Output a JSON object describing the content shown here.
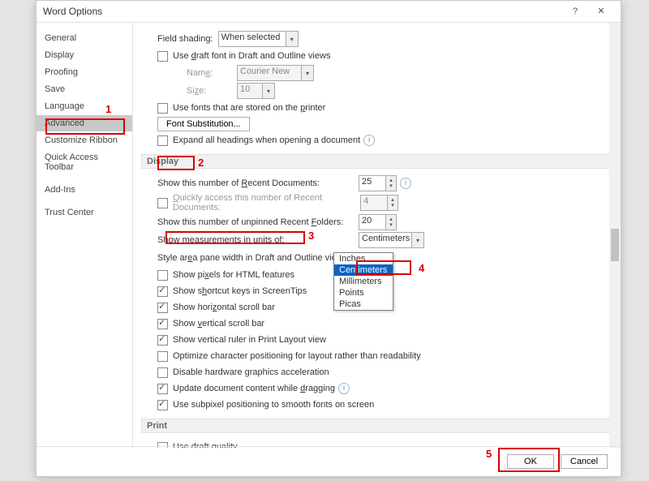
{
  "title": "Word Options",
  "sidebar": {
    "items": [
      "General",
      "Display",
      "Proofing",
      "Save",
      "Language",
      "Advanced",
      "Customize Ribbon",
      "Quick Access Toolbar",
      "Add-Ins",
      "Trust Center"
    ]
  },
  "fs": {
    "label": "Field shading:",
    "value": "When selected",
    "draftfont": "Use draft font in Draft and Outline views",
    "name_label": "Name:",
    "name_value": "Courier New",
    "size_label": "Size:",
    "size_value": "10",
    "printerfonts": "Use fonts that are stored on the printer",
    "fontsub_btn": "Font Substitution...",
    "expand": "Expand all headings when opening a document"
  },
  "sec_display": "Display",
  "disp": {
    "recent_label": "Show this number of Recent Documents:",
    "recent_value": "25",
    "quick_label": "Quickly access this number of Recent Documents:",
    "quick_value": "4",
    "folders_label": "Show this number of unpinned Recent Folders:",
    "folders_value": "20",
    "units_label": "Show measurements in units of:",
    "units_value": "Centimeters",
    "pane_label": "Style area pane width in Draft and Outline views:",
    "cb_pixels": "Show pixels for HTML features",
    "cb_shortcut": "Show shortcut keys in ScreenTips",
    "cb_hscroll": "Show horizontal scroll bar",
    "cb_vscroll": "Show vertical scroll bar",
    "cb_vruler": "Show vertical ruler in Print Layout view",
    "cb_optimize": "Optimize character positioning for layout rather than readability",
    "cb_hwaccel": "Disable hardware graphics acceleration",
    "cb_dragupdate": "Update document content while dragging",
    "cb_subpixel": "Use subpixel positioning to smooth fonts on screen"
  },
  "sec_print": "Print",
  "print": {
    "draft": "Use draft quality"
  },
  "dropdown": {
    "items": [
      "Inches",
      "Centimeters",
      "Millimeters",
      "Points",
      "Picas"
    ]
  },
  "footer": {
    "ok": "OK",
    "cancel": "Cancel"
  },
  "ann": {
    "n1": "1",
    "n2": "2",
    "n3": "3",
    "n4": "4",
    "n5": "5"
  }
}
